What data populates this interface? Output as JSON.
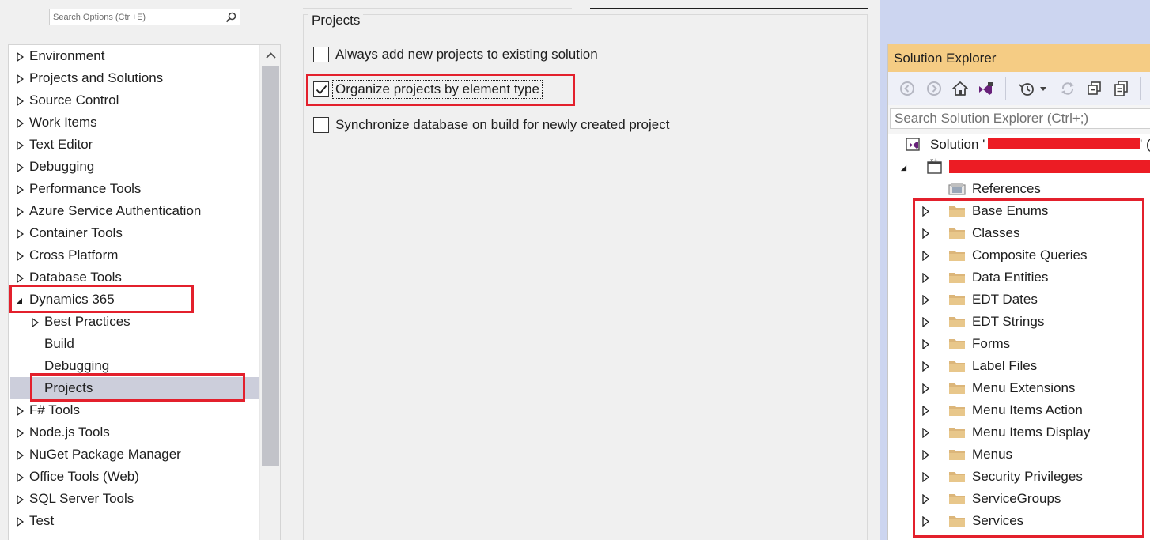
{
  "options_dialog": {
    "search_placeholder": "Search Options (Ctrl+E)",
    "tree_items": [
      {
        "label": "Environment",
        "depth": 0,
        "expander": "collapsed"
      },
      {
        "label": "Projects and Solutions",
        "depth": 0,
        "expander": "collapsed"
      },
      {
        "label": "Source Control",
        "depth": 0,
        "expander": "collapsed"
      },
      {
        "label": "Work Items",
        "depth": 0,
        "expander": "collapsed"
      },
      {
        "label": "Text Editor",
        "depth": 0,
        "expander": "collapsed"
      },
      {
        "label": "Debugging",
        "depth": 0,
        "expander": "collapsed"
      },
      {
        "label": "Performance Tools",
        "depth": 0,
        "expander": "collapsed"
      },
      {
        "label": "Azure Service Authentication",
        "depth": 0,
        "expander": "collapsed"
      },
      {
        "label": "Container Tools",
        "depth": 0,
        "expander": "collapsed"
      },
      {
        "label": "Cross Platform",
        "depth": 0,
        "expander": "collapsed"
      },
      {
        "label": "Database Tools",
        "depth": 0,
        "expander": "collapsed"
      },
      {
        "label": "Dynamics 365",
        "depth": 0,
        "expander": "expanded"
      },
      {
        "label": "Best Practices",
        "depth": 1,
        "expander": "collapsed"
      },
      {
        "label": "Build",
        "depth": 1,
        "expander": "none"
      },
      {
        "label": "Debugging",
        "depth": 1,
        "expander": "none"
      },
      {
        "label": "Projects",
        "depth": 1,
        "expander": "none",
        "selected": true
      },
      {
        "label": "F# Tools",
        "depth": 0,
        "expander": "collapsed"
      },
      {
        "label": "Node.js Tools",
        "depth": 0,
        "expander": "collapsed"
      },
      {
        "label": "NuGet Package Manager",
        "depth": 0,
        "expander": "collapsed"
      },
      {
        "label": "Office Tools (Web)",
        "depth": 0,
        "expander": "collapsed"
      },
      {
        "label": "SQL Server Tools",
        "depth": 0,
        "expander": "collapsed"
      },
      {
        "label": "Test",
        "depth": 0,
        "expander": "collapsed"
      }
    ],
    "group_title": "Projects",
    "options": [
      {
        "label": "Always add new projects to existing solution",
        "checked": false
      },
      {
        "label": "Organize projects by element type",
        "checked": true,
        "focused": true
      },
      {
        "label": "Synchronize database on build for newly created project",
        "checked": false
      }
    ]
  },
  "solution_explorer": {
    "title": "Solution Explorer",
    "search_placeholder": "Search Solution Explorer (Ctrl+;)",
    "toolbar_icons": [
      "back-icon",
      "forward-icon",
      "home-icon",
      "vs-switch-views-icon",
      "pending-changes-filter-icon",
      "dropdown-arrow-icon",
      "sync-icon",
      "collapse-all-icon",
      "copy-icon"
    ],
    "solution_prefix": "Solution '",
    "solution_suffix": "' (",
    "references_label": "References",
    "folders": [
      "Base Enums",
      "Classes",
      "Composite Queries",
      "Data Entities",
      "EDT Dates",
      "EDT Strings",
      "Forms",
      "Label Files",
      "Menu Extensions",
      "Menu Items Action",
      "Menu Items Display",
      "Menus",
      "Security Privileges",
      "ServiceGroups",
      "Services"
    ]
  },
  "colors": {
    "highlight_box": "#e3202c",
    "redaction": "#ec1c24",
    "selected_row": "#cccedb",
    "se_title_bar": "#f5cc84",
    "folder": "#dcb67a"
  }
}
